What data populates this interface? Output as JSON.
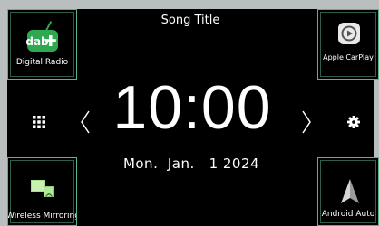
{
  "header": {
    "song_title": "Song Title"
  },
  "clock": {
    "time": "10:00",
    "date": "Mon.  Jan.   1 2024"
  },
  "shortcuts": {
    "top_left": {
      "label": "Digital Radio",
      "icon": "dab-plus-icon"
    },
    "top_right": {
      "label": "Apple CarPlay",
      "icon": "apple-carplay-icon"
    },
    "bottom_left": {
      "label": "Wireless Mirroring",
      "icon": "wireless-mirroring-icon"
    },
    "bottom_right": {
      "label": "Android Auto",
      "icon": "android-auto-icon"
    }
  },
  "controls": {
    "menu_icon": "grid-menu-icon",
    "prev_icon": "chevron-left-icon",
    "next_icon": "chevron-right-icon",
    "settings_icon": "gear-icon"
  },
  "colors": {
    "tile_border": "#55b58e",
    "dab_green": "#2fa84f",
    "bezel": "#b9bfbe",
    "background": "#000000"
  }
}
